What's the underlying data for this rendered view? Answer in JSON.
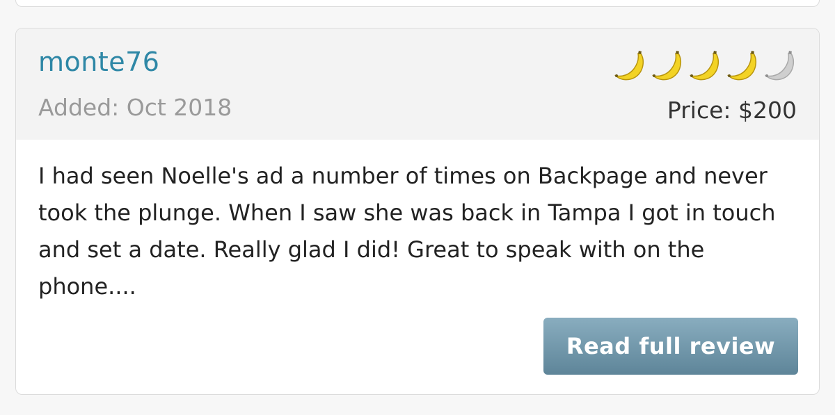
{
  "review": {
    "username": "monte76",
    "added": "Added: Oct 2018",
    "price": "Price: $200",
    "rating": {
      "value": 4,
      "max": 5,
      "icon": "banana-icon",
      "filled_color": "#f3d325",
      "empty_color": "#cfcfcf"
    },
    "text": "I had seen Noelle's ad a number of times on Backpage and never took the plunge. When I saw she was back in Tampa I got in touch and set a date. Really glad I did! Great to speak with on the phone....",
    "read_more_label": "Read full review"
  },
  "colors": {
    "username": "#2e87a6",
    "button": "#6f94a8",
    "header_bg": "#f3f3f3"
  }
}
